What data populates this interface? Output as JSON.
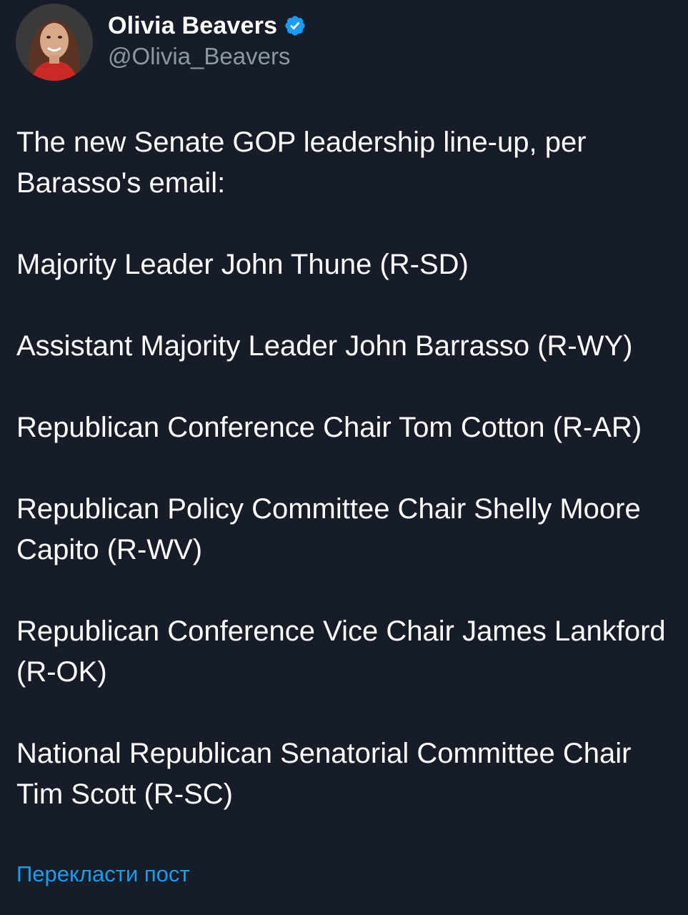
{
  "author": {
    "display_name": "Olivia Beavers",
    "handle": "@Olivia_Beavers",
    "verified_icon": "verified-badge-icon",
    "verified_color": "#1d9bf0"
  },
  "post": {
    "paragraphs": [
      "The new Senate GOP leadership line-up, per Barasso's email:",
      "Majority Leader John Thune (R-SD)",
      "Assistant Majority Leader John Barrasso (R-WY)",
      "Republican Conference Chair Tom Cotton (R-AR)",
      "Republican Policy Committee Chair Shelly Moore Capito (R-WV)",
      "Republican Conference Vice Chair James Lankford (R-OK)",
      "National Republican Senatorial Committee Chair Tim Scott (R-SC)"
    ],
    "translate_label": "Перекласти пост"
  },
  "colors": {
    "background": "#161d28",
    "text": "#ffffff",
    "secondary_text": "#8b98a5",
    "link": "#1d9bf0"
  }
}
